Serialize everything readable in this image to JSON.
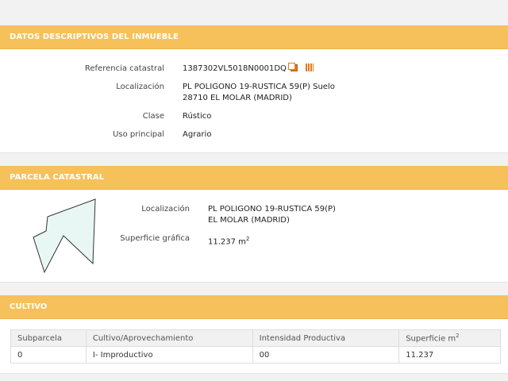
{
  "datos": {
    "header": "DATOS DESCRIPTIVOS DEL INMUEBLE",
    "referencia_label": "Referencia catastral",
    "referencia_value": "1387302VL5018N0001DQ",
    "localizacion_label": "Localización",
    "localizacion_line1": "PL POLIGONO 19-RUSTICA 59(P) Suelo",
    "localizacion_line2": "28710 EL MOLAR (MADRID)",
    "clase_label": "Clase",
    "clase_value": "Rústico",
    "uso_label": "Uso principal",
    "uso_value": "Agrario"
  },
  "parcela": {
    "header": "PARCELA CATASTRAL",
    "localizacion_label": "Localización",
    "localizacion_line1": "PL POLIGONO 19-RUSTICA 59(P)",
    "localizacion_line2": "EL MOLAR (MADRID)",
    "superficie_label": "Superficie gráfica",
    "superficie_value": "11.237 m",
    "superficie_unit_sup": "2"
  },
  "cultivo": {
    "header": "CULTIVO",
    "columns": [
      "Subparcela",
      "Cultivo/Aprovechamiento",
      "Intensidad Productiva",
      "Superficie m"
    ],
    "superficie_col_sup": "2",
    "rows": [
      [
        "0",
        "I- Improductivo",
        "00",
        "11.237"
      ]
    ]
  },
  "colors": {
    "header_bg": "#f6c15a",
    "icon_orange": "#e07b1f",
    "parcel_fill": "#e8f7f3"
  },
  "icons": [
    "copy-icon",
    "barcode-icon"
  ]
}
